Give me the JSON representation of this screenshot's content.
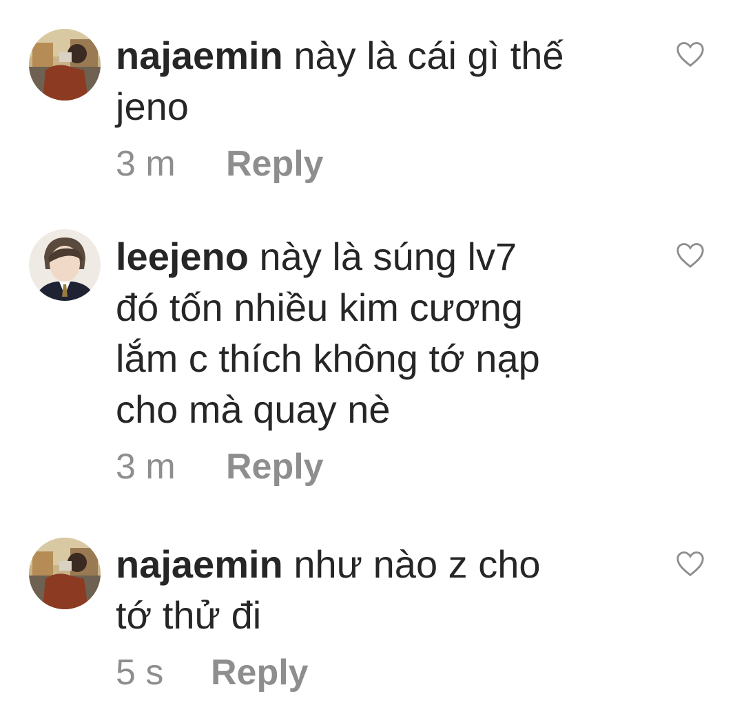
{
  "comments": [
    {
      "username": "najaemin",
      "text": "này là cái gì thế\njeno",
      "time": "3 m",
      "reply": "Reply"
    },
    {
      "username": "leejeno",
      "text": "này là súng lv7\nđó tốn nhiều kim cương\nlắm c thích không tớ nạp\ncho mà quay nè",
      "time": "3 m",
      "reply": "Reply"
    },
    {
      "username": "najaemin",
      "text": "như nào z cho\ntớ thử đi",
      "time": "5 s",
      "reply": "Reply"
    }
  ],
  "icons": {
    "like": "heart-outline-icon"
  },
  "colors": {
    "text": "#262626",
    "meta": "#8e8e8e",
    "icon": "#8e8e8e"
  }
}
